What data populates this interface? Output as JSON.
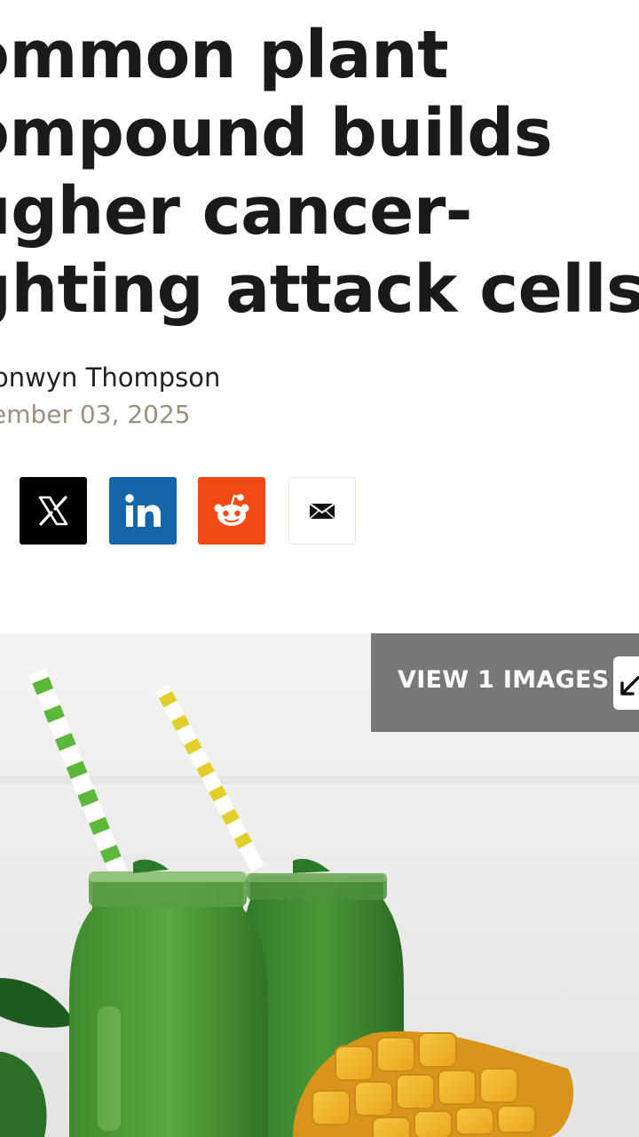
{
  "article": {
    "headline_lines": [
      "ommon plant",
      "ompound builds",
      "ugher cancer-",
      "ghting attack cells"
    ],
    "author": "onwyn Thompson",
    "date": "ember 03, 2025"
  },
  "share": {
    "icons": [
      "x-logo-icon",
      "linkedin-icon",
      "reddit-icon",
      "email-icon"
    ],
    "colors": {
      "x": "#000000",
      "linkedin": "#1466a8",
      "reddit": "#f24a14",
      "email": "#ffffff"
    },
    "linkedin_text": "in"
  },
  "hero": {
    "view_images_label": "VIEW 1 IMAGES",
    "expand_icon": "expand-arrow-icon"
  }
}
